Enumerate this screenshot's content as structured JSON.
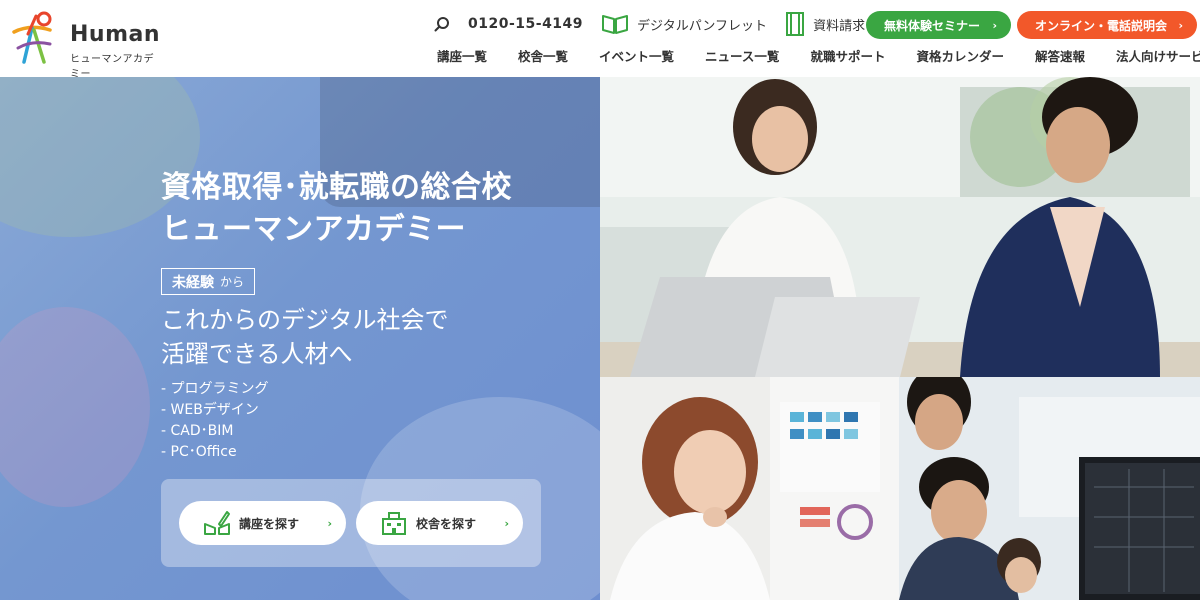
{
  "header": {
    "logo_text": "Human",
    "logo_sub": "ヒューマンアカデミー",
    "phone": "0120-15-4149",
    "pamphlet_label": "デジタルパンフレット",
    "request_label": "資料請求",
    "seminar_button": "無料体験セミナー",
    "consult_button": "オンライン・電話説明会",
    "nav": [
      "講座一覧",
      "校舎一覧",
      "イベント一覧",
      "ニュース一覧",
      "就職サポート",
      "資格カレンダー",
      "解答速報",
      "法人向けサービス"
    ]
  },
  "hero": {
    "title_line1": "資格取得･就転職の総合校",
    "title_line2": "ヒューマンアカデミー",
    "badge_main": "未経験",
    "badge_suffix": "から",
    "lead_line1": "これからのデジタル社会で",
    "lead_line2": "活躍できる人材へ",
    "list": [
      "- プログラミング",
      "- WEBデザイン",
      "- CAD･BIM",
      "- PC･Office"
    ],
    "cta_course": "講座を探す",
    "cta_school": "校舎を探す"
  },
  "colors": {
    "green": "#3aa642",
    "orange": "#f2582a",
    "hero_blue": "#7497d0"
  },
  "icons": {
    "search": "search-icon",
    "pamphlet": "book-icon",
    "request": "document-icon",
    "course": "pen-book-icon",
    "school": "building-icon"
  }
}
